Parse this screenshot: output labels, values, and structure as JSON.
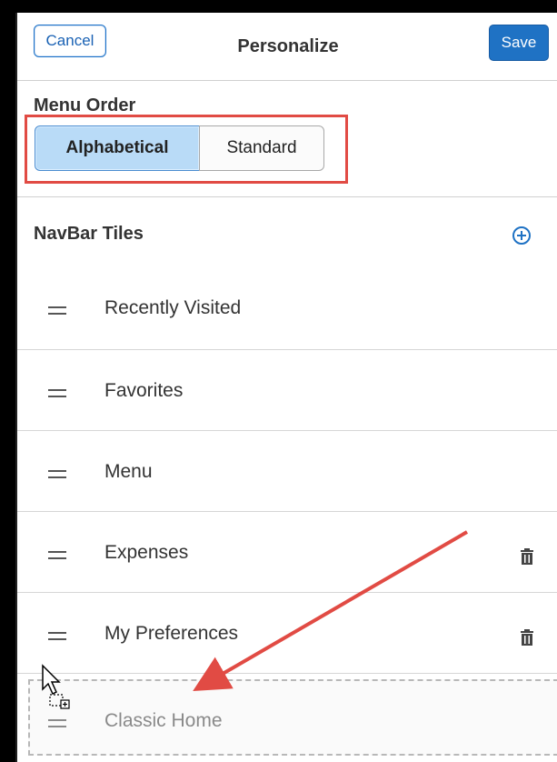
{
  "header": {
    "cancel_label": "Cancel",
    "title": "Personalize",
    "save_label": "Save"
  },
  "menu_order": {
    "label": "Menu Order",
    "options": [
      "Alphabetical",
      "Standard"
    ],
    "selected": "Alphabetical"
  },
  "navbar_tiles": {
    "label": "NavBar Tiles",
    "add_icon": "plus-circle-icon",
    "items": [
      {
        "label": "Recently Visited",
        "deletable": false
      },
      {
        "label": "Favorites",
        "deletable": false
      },
      {
        "label": "Menu",
        "deletable": false
      },
      {
        "label": "Expenses",
        "deletable": true
      },
      {
        "label": "My Preferences",
        "deletable": true
      }
    ],
    "dragging_item": "Classic Home"
  },
  "colors": {
    "accent": "#1f72c4",
    "selected_segment": "#b9dbf7",
    "annotation": "#e14b44"
  }
}
